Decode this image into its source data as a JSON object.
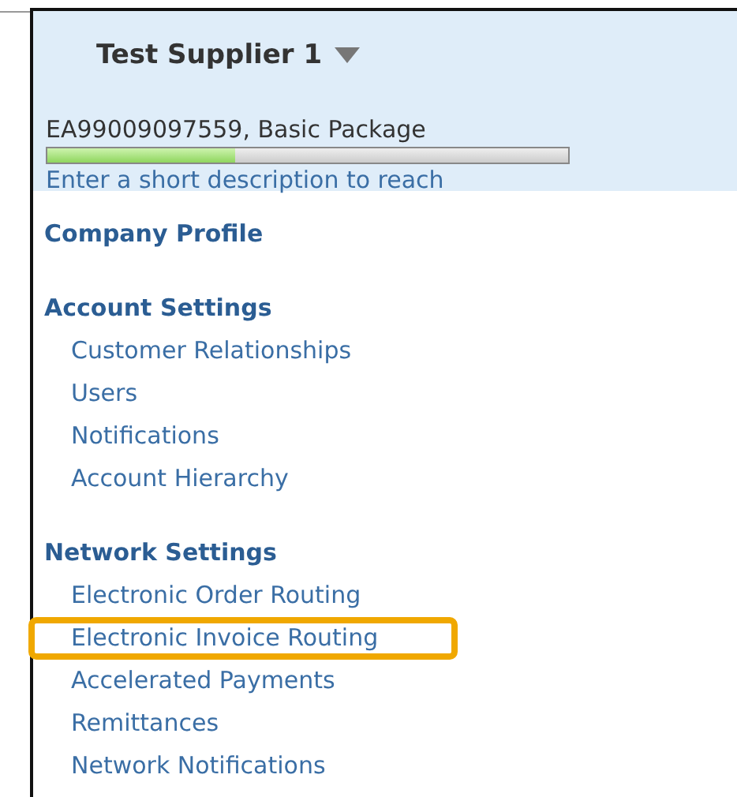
{
  "supplier": {
    "name": "Test Supplier 1",
    "account": "EA99009097559, Basic Package",
    "level": 0.36,
    "profile_hint": "Enter a short description to reach"
  },
  "nav": [
    {
      "kind": "link",
      "label": "Company Profile"
    },
    {
      "kind": "section",
      "label": "Account Settings",
      "items": [
        {
          "label": "Customer Relationships",
          "highlighted": false
        },
        {
          "label": "Users",
          "highlighted": false
        },
        {
          "label": "Notifications",
          "highlighted": false
        },
        {
          "label": "Account Hierarchy",
          "highlighted": false
        }
      ]
    },
    {
      "kind": "section",
      "label": "Network Settings",
      "items": [
        {
          "label": "Electronic Order Routing",
          "highlighted": false
        },
        {
          "label": "Electronic Invoice Routing",
          "highlighted": true
        },
        {
          "label": "Accelerated Payments",
          "highlighted": false
        },
        {
          "label": "Remittances",
          "highlighted": false
        },
        {
          "label": "Network Notifications",
          "highlighted": false
        }
      ]
    }
  ]
}
